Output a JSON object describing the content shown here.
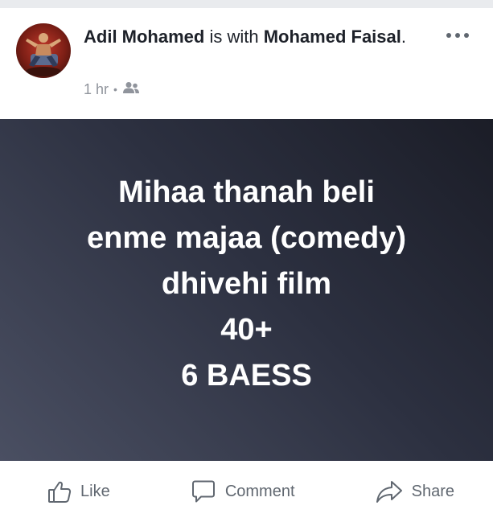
{
  "post": {
    "author": "Adil Mohamed",
    "with_text": "is with",
    "tagged": "Mohamed Faisal",
    "tagged_suffix": ".",
    "time": "1 hr",
    "separator": "•",
    "audience_icon": "friends-icon",
    "more_icon": "more-options-icon",
    "avatar_icon": "profile-photo"
  },
  "canvas": {
    "lines": [
      "Mihaa thanah beli",
      "enme majaa (comedy)",
      "dhivehi film",
      "40+",
      "6 BAESS"
    ],
    "background_colors": [
      "#4a4f62",
      "#1b1d27"
    ]
  },
  "actions": {
    "like": {
      "label": "Like",
      "icon": "thumbs-up-icon"
    },
    "comment": {
      "label": "Comment",
      "icon": "comment-bubble-icon"
    },
    "share": {
      "label": "Share",
      "icon": "share-arrow-icon"
    }
  },
  "colors": {
    "text_primary": "#1d2129",
    "text_secondary": "#90949c",
    "action_gray": "#606770"
  }
}
